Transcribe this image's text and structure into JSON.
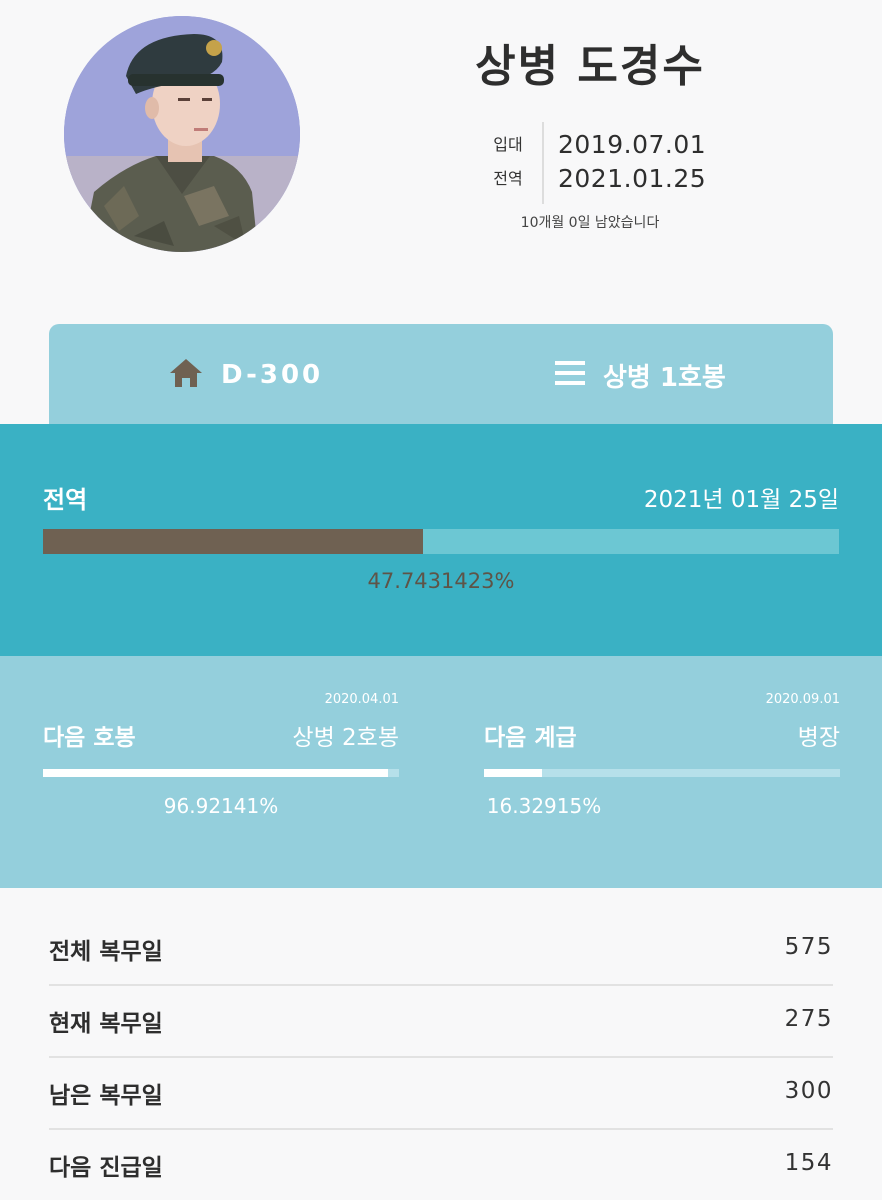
{
  "profile": {
    "name": "상병 도경수",
    "enlist_label": "입대",
    "enlist_date": "2019.07.01",
    "discharge_label": "전역",
    "discharge_date": "2021.01.25",
    "remaining_text": "10개월 0일 남았습니다"
  },
  "tabs": [
    {
      "label": "D-300",
      "icon": "home-icon"
    },
    {
      "label": "상병 1호봉",
      "icon": "menu-icon"
    }
  ],
  "discharge": {
    "title": "전역",
    "date_text": "2021년 01월 25일",
    "percent": 47.7431423,
    "percent_text": "47.7431423%"
  },
  "next_pay": {
    "date": "2020.04.01",
    "title": "다음 호봉",
    "value": "상병 2호봉",
    "percent": 96.92141,
    "percent_text": "96.92141%"
  },
  "next_rank": {
    "date": "2020.09.01",
    "title": "다음 계급",
    "value": "병장",
    "percent": 16.32915,
    "percent_text": "16.32915%"
  },
  "stats": [
    {
      "label": "전체 복무일",
      "value": "575"
    },
    {
      "label": "현재 복무일",
      "value": "275"
    },
    {
      "label": "남은 복무일",
      "value": "300"
    },
    {
      "label": "다음 진급일",
      "value": "154"
    }
  ],
  "colors": {
    "background": "#f8f8f9",
    "tab_card": "#94cfdc",
    "main_section": "#3ab1c4",
    "main_track": "#6cc7d3",
    "main_fill": "#6f6152",
    "next_section": "#94cfdc",
    "icon": "#6f6152"
  }
}
